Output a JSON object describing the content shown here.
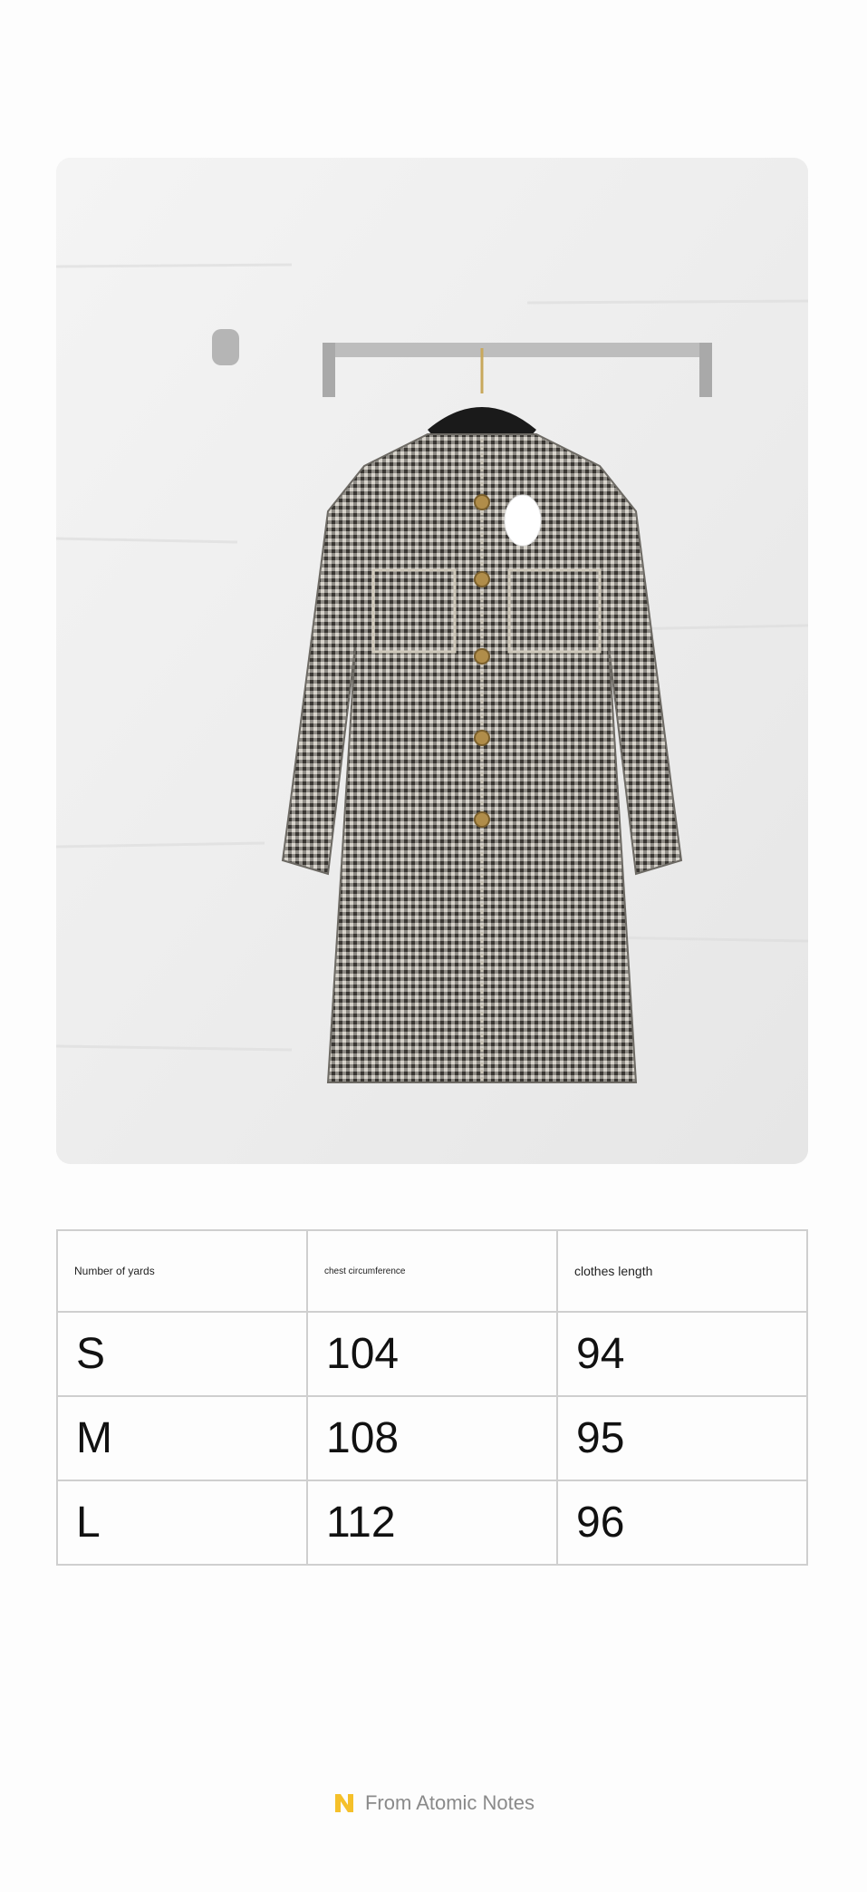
{
  "product_image": {
    "icon": "houndstooth-coat-photo"
  },
  "size_table": {
    "headers": [
      "Number of yards",
      "chest circumference",
      "clothes length"
    ],
    "rows": [
      [
        "S",
        "104",
        "94"
      ],
      [
        "M",
        "108",
        "95"
      ],
      [
        "L",
        "112",
        "96"
      ]
    ]
  },
  "footer": {
    "label": "From Atomic Notes",
    "icon": "atomic-notes-logo-icon",
    "logo_color": "#f5c02a"
  }
}
